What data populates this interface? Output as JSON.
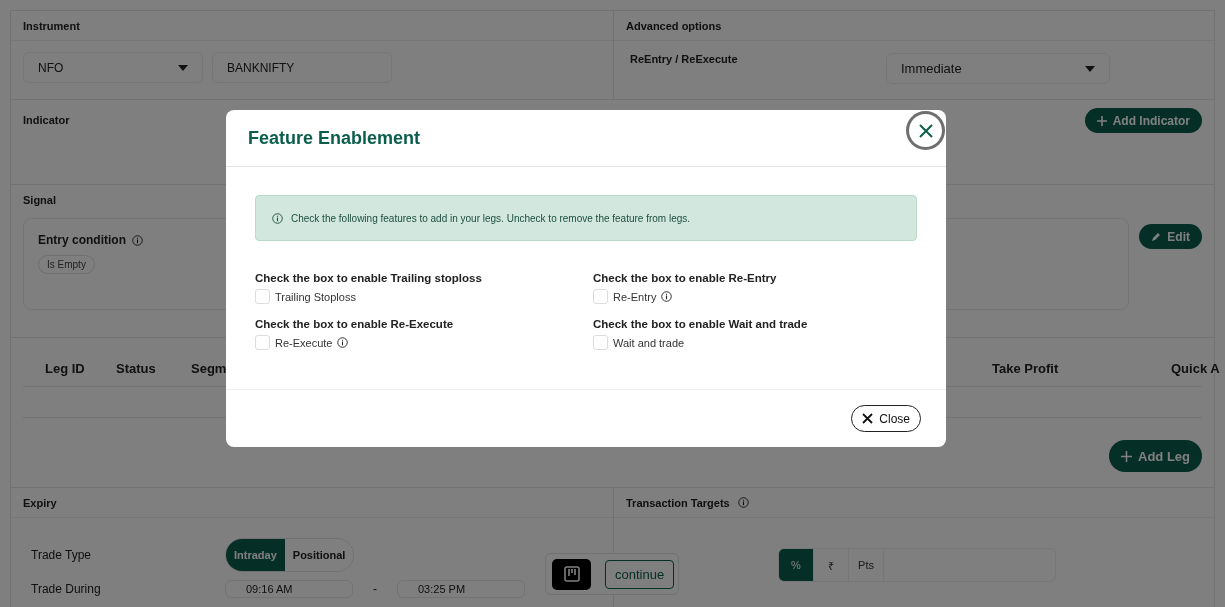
{
  "instrument": {
    "title": "Instrument",
    "exchange": "NFO",
    "symbol": "BANKNIFTY"
  },
  "advanced_options": {
    "title": "Advanced options",
    "reentry_label": "ReEntry / ReExecute",
    "reentry_value": "Immediate"
  },
  "indicator": {
    "title": "Indicator",
    "add_button": "Add Indicator"
  },
  "signal": {
    "title": "Signal",
    "entry_condition": "Entry condition",
    "chip": "Is Empty",
    "edit_button": "Edit"
  },
  "legs": {
    "columns": [
      "Leg ID",
      "Status",
      "Segm",
      "Take Profit",
      "Quick A"
    ],
    "add_button": "Add Leg"
  },
  "expiry": {
    "title": "Expiry",
    "trade_type_label": "Trade Type",
    "trade_types": [
      {
        "label": "Intraday",
        "selected": true
      },
      {
        "label": "Positional",
        "selected": false
      }
    ],
    "trade_during_label": "Trade During",
    "start_time": "09:16 AM",
    "time_separator": "-",
    "end_time": "03:25 PM"
  },
  "transaction_targets": {
    "title": "Transaction Targets",
    "units": [
      {
        "label": "%",
        "selected": true
      },
      {
        "label": "₹",
        "selected": false
      },
      {
        "label": "Pts",
        "selected": false
      }
    ]
  },
  "floating_widget": {
    "continue_button": "continue"
  },
  "modal": {
    "title": "Feature Enablement",
    "info": "Check the following features to add in your legs. Uncheck to remove the feature from legs.",
    "features": [
      {
        "heading": "Check the box to enable Trailing stoploss",
        "label": "Trailing Stoploss",
        "checked": false,
        "info_icon": false
      },
      {
        "heading": "Check the box to enable Re-Entry",
        "label": "Re-Entry",
        "checked": false,
        "info_icon": true
      },
      {
        "heading": "Check the box to enable Re-Execute",
        "label": "Re-Execute",
        "checked": false,
        "info_icon": true
      },
      {
        "heading": "Check the box to enable Wait and trade",
        "label": "Wait and trade",
        "checked": false,
        "info_icon": false
      }
    ],
    "close_button": "Close"
  }
}
